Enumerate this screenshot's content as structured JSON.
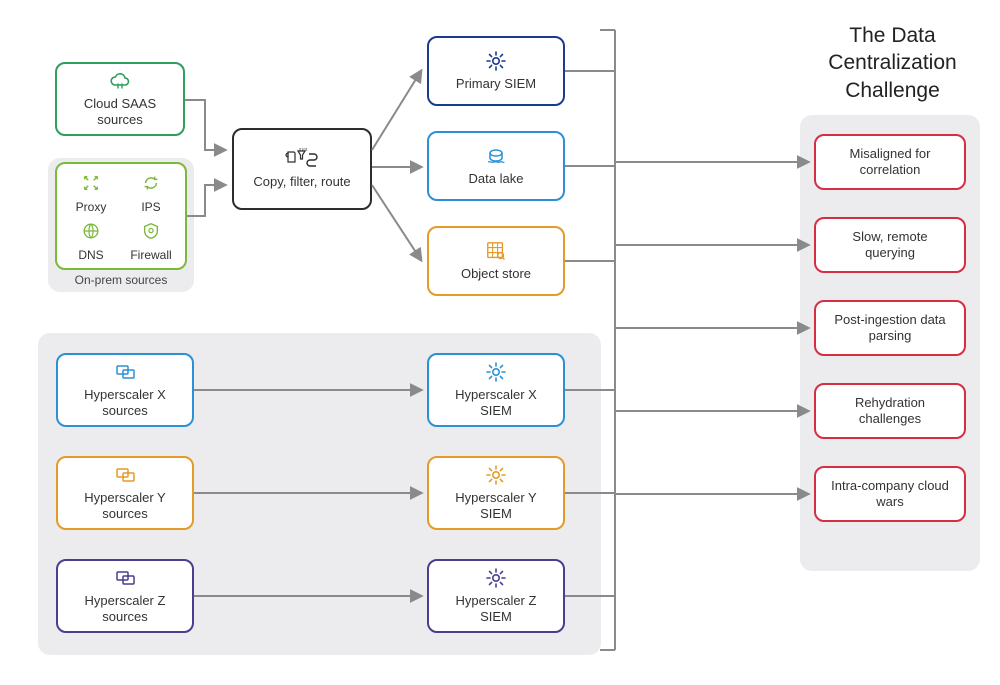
{
  "colors": {
    "green": "#2e9e5b",
    "lime": "#7bb93a",
    "dark": "#2d2d2d",
    "navy": "#1a3b8f",
    "blue": "#2a91d6",
    "orange": "#e59a2a",
    "purple": "#4b3d91",
    "red": "#d62d43",
    "panel": "#ececee",
    "arrow": "#8a8a8a"
  },
  "top": {
    "cloud_saas": "Cloud SAAS sources",
    "onprem_label": "On-prem sources",
    "onprem": {
      "proxy": "Proxy",
      "ips": "IPS",
      "dns": "DNS",
      "firewall": "Firewall"
    },
    "router": "Copy, filter, route",
    "dest": {
      "primary_siem": "Primary SIEM",
      "data_lake": "Data lake",
      "object_store": "Object store"
    }
  },
  "hyperscalers": {
    "x_src": "Hyperscaler X sources",
    "x_siem": "Hyperscaler X SIEM",
    "y_src": "Hyperscaler Y sources",
    "y_siem": "Hyperscaler Y SIEM",
    "z_src": "Hyperscaler Z sources",
    "z_siem": "Hyperscaler Z SIEM"
  },
  "challenges": {
    "title": "The Data Centralization Challenge",
    "c1": "Misaligned for correlation",
    "c2": "Slow, remote querying",
    "c3": "Post-ingestion data parsing",
    "c4": "Rehydration challenges",
    "c5": "Intra-company cloud wars"
  }
}
